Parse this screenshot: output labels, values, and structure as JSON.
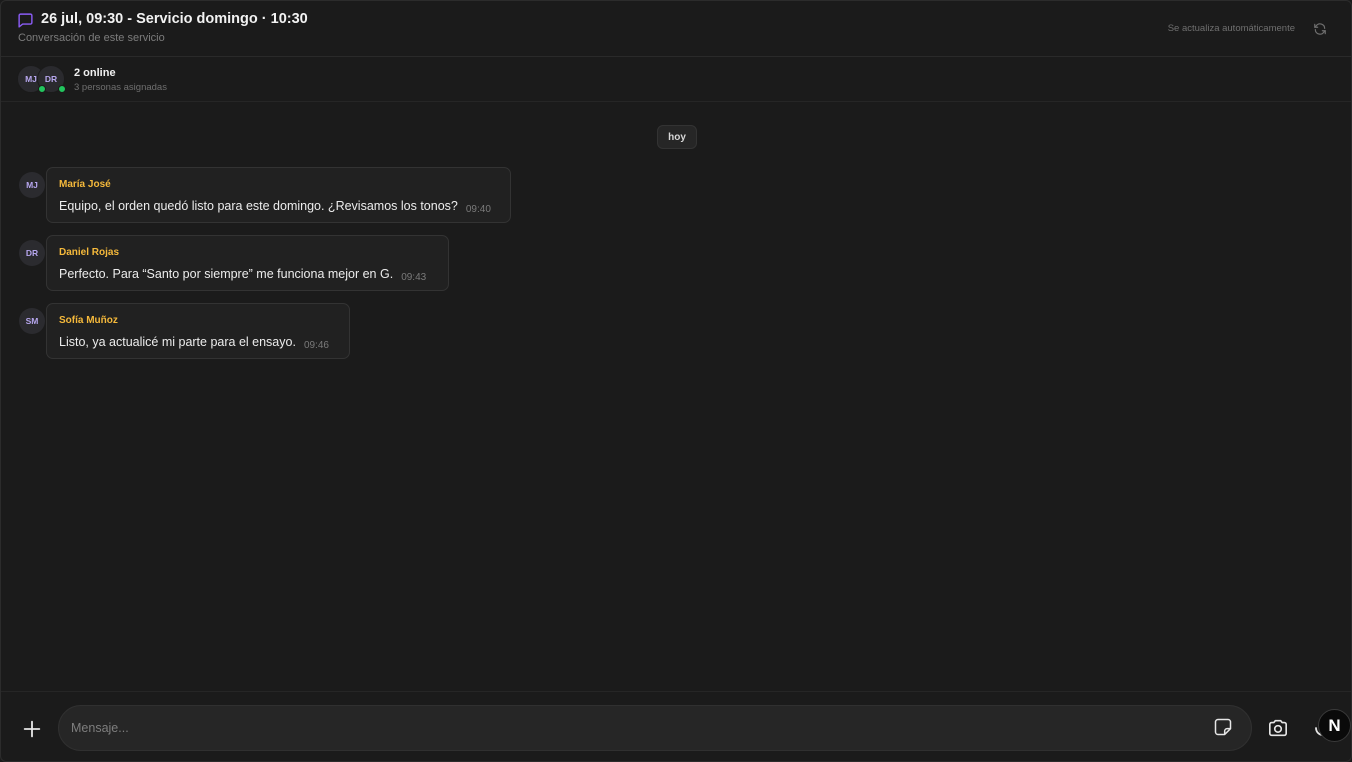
{
  "header": {
    "title": "26 jul, 09:30 - Servicio domingo · 10:30",
    "subtitle": "Conversación de este servicio",
    "autoupdate": "Se actualiza automáticamente",
    "icons": {
      "chat": "chat-bubble-icon",
      "refresh": "refresh-icon"
    }
  },
  "presence": {
    "avatars": [
      "MJ",
      "DR"
    ],
    "online": "2 online",
    "assigned": "3 personas asignadas"
  },
  "date_label": "hoy",
  "messages": [
    {
      "initials": "MJ",
      "author": "María José",
      "text": "Equipo, el orden quedó listo para este domingo. ¿Revisamos los tonos?",
      "time": "09:40"
    },
    {
      "initials": "DR",
      "author": "Daniel Rojas",
      "text": "Perfecto. Para “Santo por siempre” me funciona mejor en G.",
      "time": "09:43"
    },
    {
      "initials": "SM",
      "author": "Sofía Muñoz",
      "text": "Listo, ya actualicé mi parte para el ensayo.",
      "time": "09:46"
    }
  ],
  "composer": {
    "placeholder": "Mensaje...",
    "badge": "N",
    "icons": {
      "add": "plus-icon",
      "sticker": "sticker-icon",
      "camera": "camera-icon",
      "mic": "microphone-icon"
    }
  },
  "colors": {
    "background": "#1b1b1b",
    "accent_purple": "#8b5cf6",
    "author_gold": "#f5b93b",
    "online_green": "#22c55e",
    "avatar_text": "#b7a7ef"
  }
}
